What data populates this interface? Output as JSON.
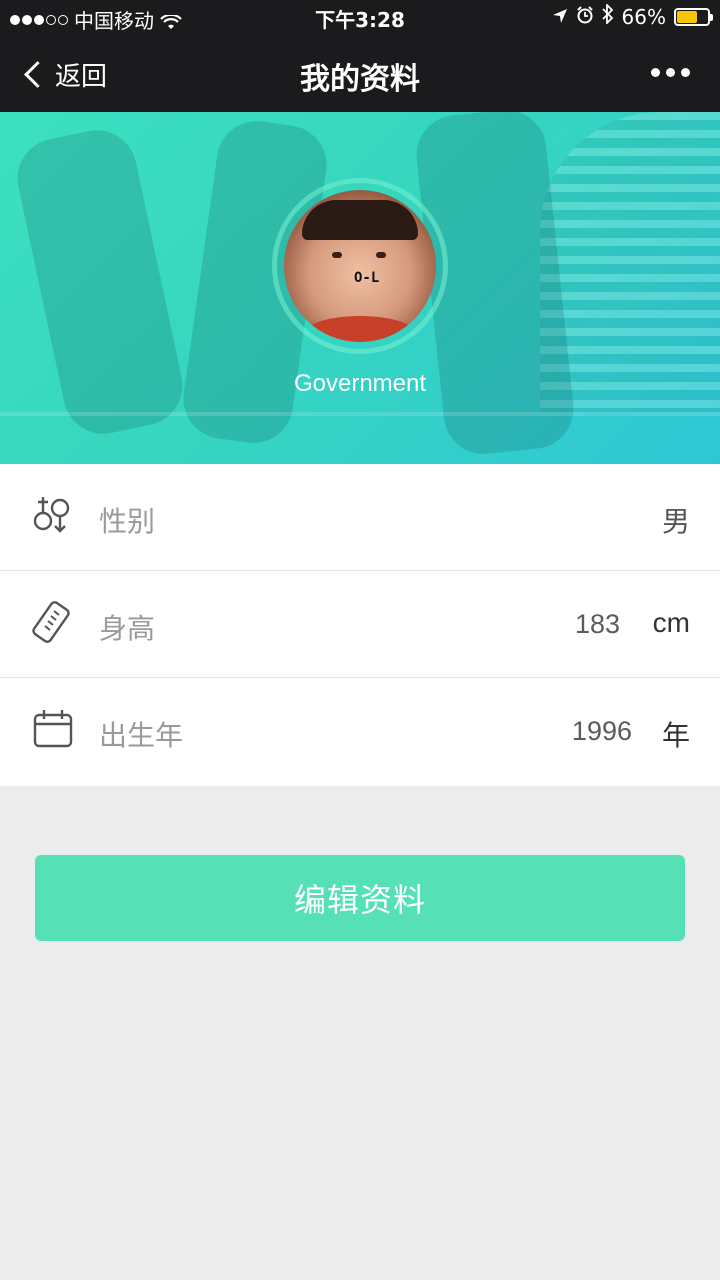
{
  "status_bar": {
    "carrier": "中国移动",
    "time": "下午3:28",
    "battery": "66%",
    "battery_level": 0.66,
    "signal_dots": [
      true,
      true,
      true,
      false,
      false
    ]
  },
  "nav": {
    "back_label": "返回",
    "title": "我的资料"
  },
  "profile": {
    "username": "Government",
    "avatar_mark": "O-L"
  },
  "rows": [
    {
      "icon": "gender-icon",
      "label": "性别",
      "value": "男",
      "unit": ""
    },
    {
      "icon": "ruler-icon",
      "label": "身高",
      "value": "183",
      "unit": "cm"
    },
    {
      "icon": "calendar-icon",
      "label": "出生年",
      "value": "1996",
      "unit": "年"
    }
  ],
  "edit_button": {
    "label": "编辑资料"
  },
  "colors": {
    "nav_bg": "#1b1b1d",
    "accent": "#55e0b5",
    "hero_start": "#3de0c0",
    "hero_end": "#2fc7d6",
    "battery": "#f7c600"
  }
}
